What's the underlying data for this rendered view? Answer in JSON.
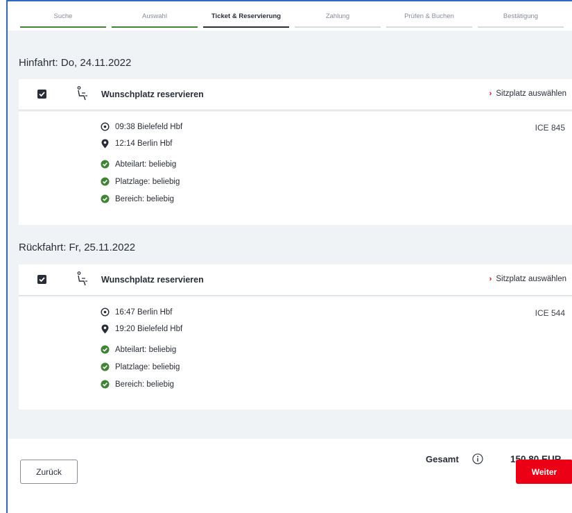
{
  "stepper": {
    "steps": [
      {
        "label": "Suche",
        "state": "done"
      },
      {
        "label": "Auswahl",
        "state": "done"
      },
      {
        "label": "Ticket & Reservierung",
        "state": "active"
      },
      {
        "label": "Zahlung",
        "state": "open"
      },
      {
        "label": "Prüfen & Buchen",
        "state": "open"
      },
      {
        "label": "Bestätigung",
        "state": "open"
      }
    ]
  },
  "outbound": {
    "title": "Hinfahrt: Do, 24.11.2022",
    "reservation_title": "Wunschplatz reservieren",
    "seat_link": "Sitzplatz auswählen",
    "departure": "09:38 Bielefeld Hbf",
    "arrival": "12:14 Berlin Hbf",
    "train": "ICE 845",
    "options": [
      "Abteilart: beliebig",
      "Platzlage: beliebig",
      "Bereich:  beliebig"
    ],
    "checked": true
  },
  "return": {
    "title": "Rückfahrt: Fr, 25.11.2022",
    "reservation_title": "Wunschplatz reservieren",
    "seat_link": "Sitzplatz auswählen",
    "departure": "16:47 Berlin Hbf",
    "arrival": "19:20 Bielefeld Hbf",
    "train": "ICE 544",
    "options": [
      "Abteilart: beliebig",
      "Platzlage: beliebig",
      "Bereich:  beliebig"
    ],
    "checked": true
  },
  "footer": {
    "total_label": "Gesamt",
    "total_value": "150,80 EUR",
    "back_label": "Zurück",
    "next_label": "Weiter"
  },
  "colors": {
    "accent_red": "#ec0016",
    "done_green": "#408335",
    "check_green": "#408335",
    "text_dark": "#282d37"
  },
  "icons": {
    "checkbox": "checkbox-checked-icon",
    "seat": "seat-icon",
    "departure": "clock-circle-icon",
    "arrival": "location-pin-icon",
    "option": "check-circle-icon",
    "link": "chevron-right-icon",
    "info": "info-icon"
  }
}
